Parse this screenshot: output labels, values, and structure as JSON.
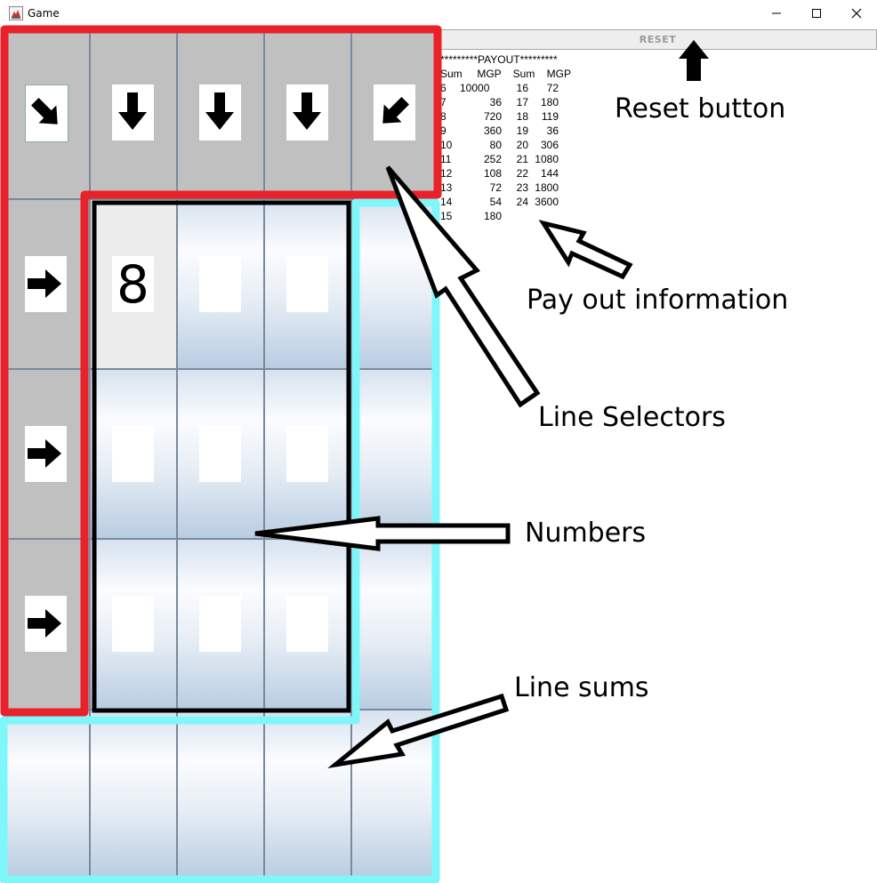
{
  "window": {
    "title": "Game",
    "app_icon": "java-icon",
    "controls": [
      "minimize-icon",
      "maximize-icon",
      "close-icon"
    ]
  },
  "reset_button": {
    "label": "RESET"
  },
  "payout": {
    "header": "*********PAYOUT*********",
    "columns": [
      "Sum",
      "MGP",
      "Sum",
      "MGP"
    ],
    "rows": [
      [
        "6",
        "10000",
        "16",
        "72"
      ],
      [
        "7",
        "36",
        "17",
        "180"
      ],
      [
        "8",
        "720",
        "18",
        "119"
      ],
      [
        "9",
        "360",
        "19",
        "36"
      ],
      [
        "10",
        "80",
        "20",
        "306"
      ],
      [
        "11",
        "252",
        "21",
        "1080"
      ],
      [
        "12",
        "108",
        "22",
        "144"
      ],
      [
        "13",
        "72",
        "23",
        "1800"
      ],
      [
        "14",
        "54",
        "24",
        "3600"
      ],
      [
        "15",
        "180",
        "",
        ""
      ]
    ]
  },
  "board": {
    "line_selectors_top": [
      "arrow-down-right-icon",
      "arrow-down-icon",
      "arrow-down-icon",
      "arrow-down-icon",
      "arrow-down-left-icon"
    ],
    "line_selectors_left": [
      "arrow-right-icon",
      "arrow-right-icon",
      "arrow-right-icon"
    ],
    "numbers": [
      [
        "8",
        "",
        ""
      ],
      [
        "",
        "",
        ""
      ],
      [
        "",
        "",
        ""
      ]
    ],
    "revealed": [
      [
        true,
        false,
        false
      ],
      [
        false,
        false,
        false
      ],
      [
        false,
        false,
        false
      ]
    ],
    "line_sums_right": [
      "",
      "",
      ""
    ],
    "line_sums_bottom": [
      "",
      "",
      "",
      "",
      ""
    ]
  },
  "annotations": {
    "reset": "Reset button",
    "payout": "Pay out information",
    "line_selectors": "Line Selectors",
    "numbers": "Numbers",
    "line_sums": "Line sums"
  },
  "colors": {
    "line_selectors_outline": "#e8212a",
    "numbers_outline": "#000000",
    "line_sums_outline": "#7ff7fa"
  }
}
